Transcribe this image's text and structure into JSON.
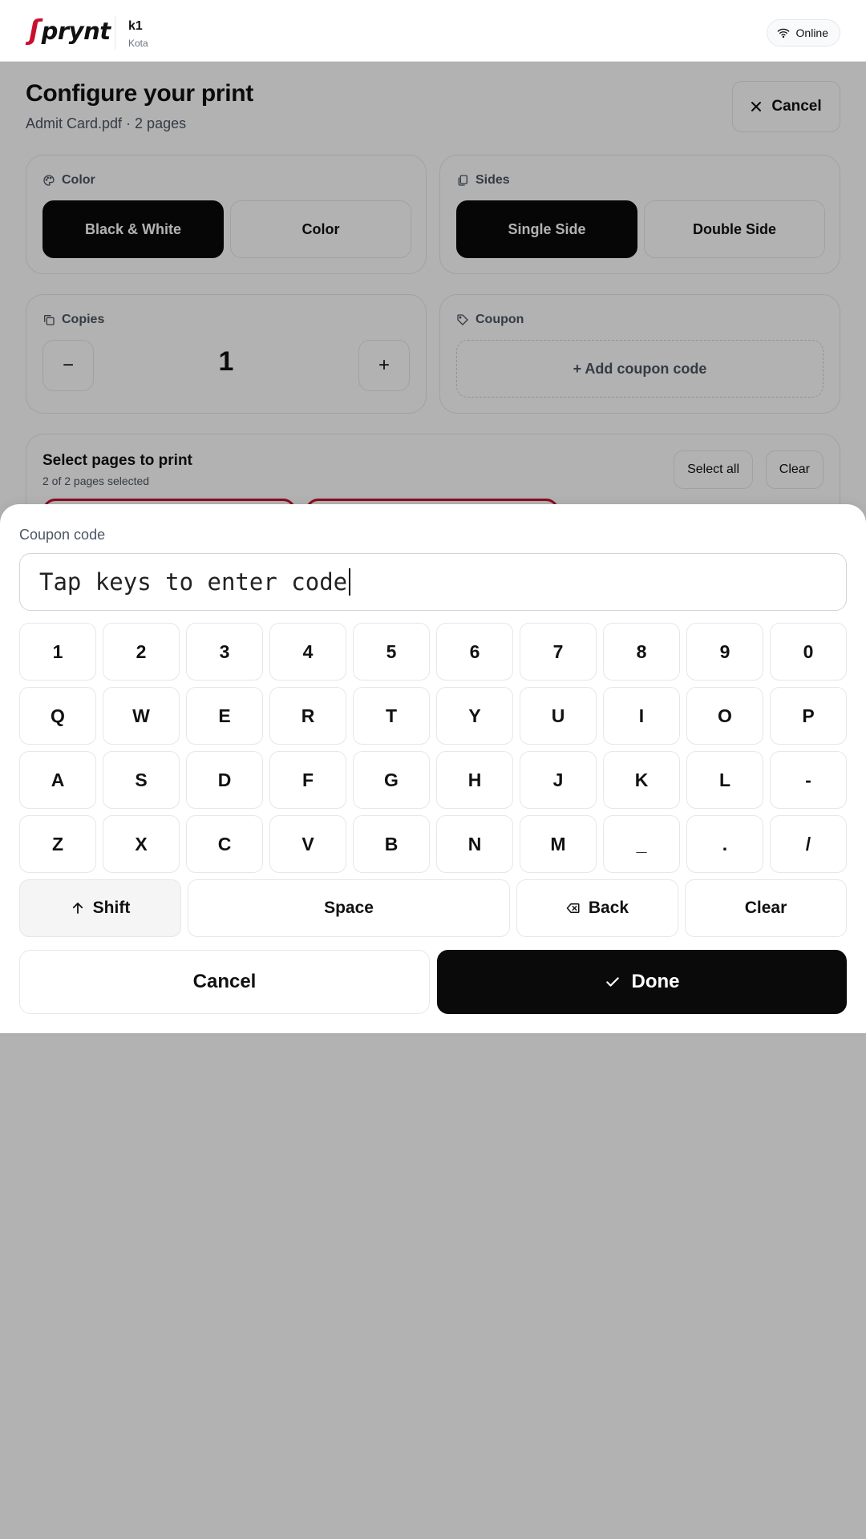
{
  "header": {
    "brand": "prynt",
    "brand_mark": "ʃ",
    "kiosk_name": "k1",
    "kiosk_city": "Kota",
    "status": "Online",
    "status_icon": "wifi-icon"
  },
  "config": {
    "title": "Configure your print",
    "subtitle": "Admit Card.pdf · 2 pages",
    "cancel_label": "Cancel",
    "color": {
      "label": "Color",
      "options": [
        "Black & White",
        "Color"
      ],
      "selected": "Black & White"
    },
    "sides": {
      "label": "Sides",
      "options": [
        "Single Side",
        "Double Side"
      ],
      "selected": "Single Side"
    },
    "copies": {
      "label": "Copies",
      "value": "1",
      "minus": "−",
      "plus": "+"
    },
    "coupon": {
      "label": "Coupon",
      "add_label": "+ Add coupon code"
    },
    "pages": {
      "title": "Select pages to print",
      "subtitle": "2 of 2 pages selected",
      "select_all": "Select all",
      "clear": "Clear"
    }
  },
  "keyboard": {
    "label": "Coupon code",
    "placeholder": "Tap keys to enter code",
    "rows": [
      [
        "1",
        "2",
        "3",
        "4",
        "5",
        "6",
        "7",
        "8",
        "9",
        "0"
      ],
      [
        "Q",
        "W",
        "E",
        "R",
        "T",
        "Y",
        "U",
        "I",
        "O",
        "P"
      ],
      [
        "A",
        "S",
        "D",
        "F",
        "G",
        "H",
        "J",
        "K",
        "L",
        "-"
      ],
      [
        "Z",
        "X",
        "C",
        "V",
        "B",
        "N",
        "M",
        "_",
        ".",
        "/"
      ]
    ],
    "shift": "Shift",
    "space": "Space",
    "back": "Back",
    "clear": "Clear",
    "cancel": "Cancel",
    "done": "Done"
  },
  "colors": {
    "brand_red": "#c8102e",
    "primary": "#0a0a0a",
    "border": "#e5e7eb",
    "muted_text": "#4b5563"
  }
}
